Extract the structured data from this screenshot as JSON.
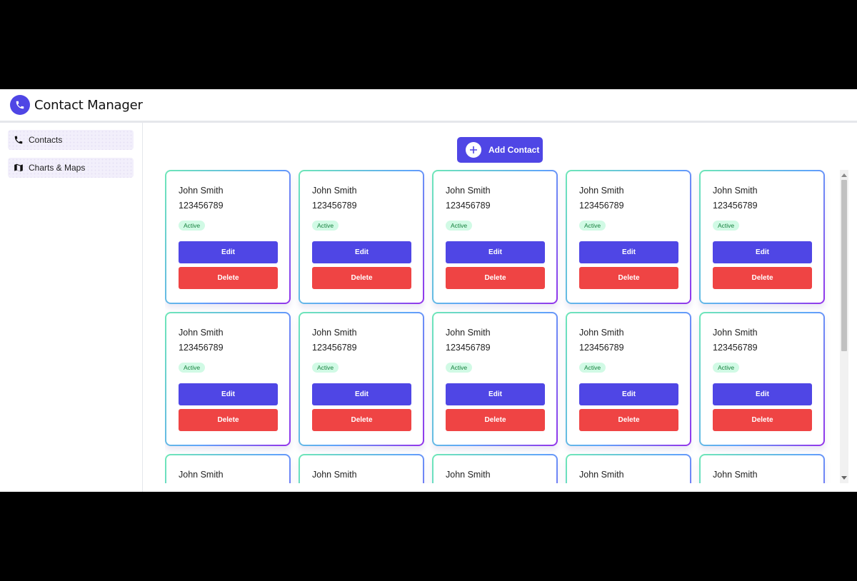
{
  "header": {
    "title": "Contact Manager",
    "logo_icon": "phone-icon"
  },
  "sidebar": {
    "items": [
      {
        "label": "Contacts",
        "icon": "phone-icon"
      },
      {
        "label": "Charts & Maps",
        "icon": "map-icon"
      }
    ]
  },
  "toolbar": {
    "add_label": "Add Contact",
    "add_icon": "plus-circle-icon"
  },
  "contacts": [
    {
      "name": "John Smith",
      "phone": "123456789",
      "status": "Active",
      "edit": "Edit",
      "delete": "Delete"
    },
    {
      "name": "John Smith",
      "phone": "123456789",
      "status": "Active",
      "edit": "Edit",
      "delete": "Delete"
    },
    {
      "name": "John Smith",
      "phone": "123456789",
      "status": "Active",
      "edit": "Edit",
      "delete": "Delete"
    },
    {
      "name": "John Smith",
      "phone": "123456789",
      "status": "Active",
      "edit": "Edit",
      "delete": "Delete"
    },
    {
      "name": "John Smith",
      "phone": "123456789",
      "status": "Active",
      "edit": "Edit",
      "delete": "Delete"
    },
    {
      "name": "John Smith",
      "phone": "123456789",
      "status": "Active",
      "edit": "Edit",
      "delete": "Delete"
    },
    {
      "name": "John Smith",
      "phone": "123456789",
      "status": "Active",
      "edit": "Edit",
      "delete": "Delete"
    },
    {
      "name": "John Smith",
      "phone": "123456789",
      "status": "Active",
      "edit": "Edit",
      "delete": "Delete"
    },
    {
      "name": "John Smith",
      "phone": "123456789",
      "status": "Active",
      "edit": "Edit",
      "delete": "Delete"
    },
    {
      "name": "John Smith",
      "phone": "123456789",
      "status": "Active",
      "edit": "Edit",
      "delete": "Delete"
    },
    {
      "name": "John Smith",
      "phone": "",
      "status": "",
      "edit": "",
      "delete": ""
    },
    {
      "name": "John Smith",
      "phone": "",
      "status": "",
      "edit": "",
      "delete": ""
    },
    {
      "name": "John Smith",
      "phone": "",
      "status": "",
      "edit": "",
      "delete": ""
    },
    {
      "name": "John Smith",
      "phone": "",
      "status": "",
      "edit": "",
      "delete": ""
    },
    {
      "name": "John Smith",
      "phone": "",
      "status": "",
      "edit": "",
      "delete": ""
    }
  ],
  "colors": {
    "primary": "#4f46e5",
    "danger": "#ef4444",
    "status_active_bg": "#d1fae5",
    "status_active_text": "#15803d"
  }
}
